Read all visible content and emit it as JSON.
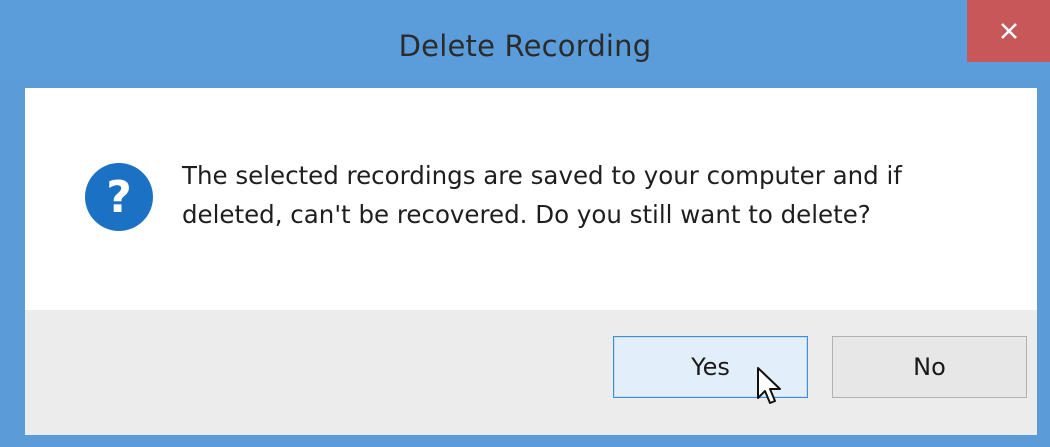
{
  "dialog": {
    "title": "Delete Recording",
    "close_label": "✕",
    "icon": "question-icon",
    "icon_glyph": "?",
    "message_line1": "The selected recordings are saved to your computer and if",
    "message_line2": "deleted, can't be recovered. Do you still want to delete?",
    "yes_label": "Yes",
    "no_label": "No"
  },
  "colors": {
    "titlebar": "#5b9ddb",
    "close_button": "#c8575a",
    "icon_blue": "#1b72c4",
    "footer": "#ececec",
    "focused_button_border": "#3c8fd8"
  },
  "cursor": "arrow-pointer-icon"
}
